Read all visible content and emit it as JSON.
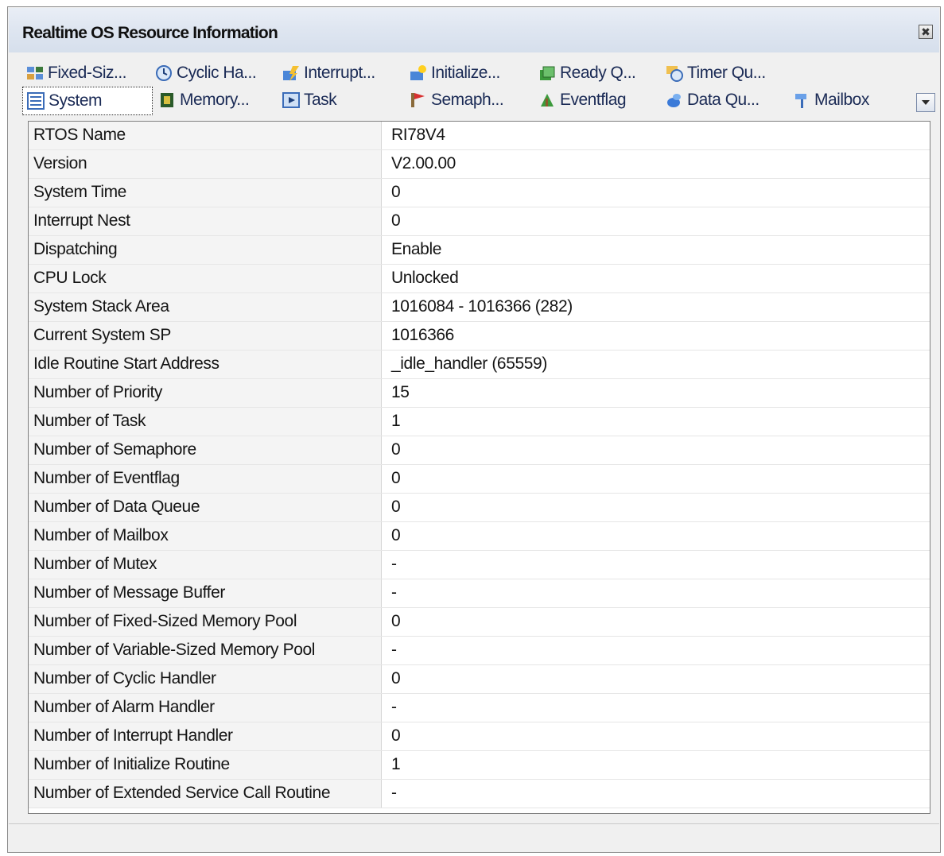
{
  "window": {
    "title": "Realtime OS Resource Information"
  },
  "tabs": {
    "row1": [
      {
        "id": "fixed",
        "label": "Fixed-Siz...",
        "icon": "fixed-size-memory-pool-icon"
      },
      {
        "id": "cyclic",
        "label": "Cyclic Ha...",
        "icon": "cyclic-handler-icon"
      },
      {
        "id": "interrupt",
        "label": "Interrupt...",
        "icon": "interrupt-handler-icon"
      },
      {
        "id": "initialize",
        "label": "Initialize...",
        "icon": "initialize-routine-icon"
      },
      {
        "id": "ready",
        "label": "Ready Q...",
        "icon": "ready-queue-icon"
      },
      {
        "id": "timer",
        "label": "Timer Qu...",
        "icon": "timer-queue-icon"
      }
    ],
    "row2": [
      {
        "id": "system",
        "label": "System",
        "icon": "system-icon",
        "selected": true
      },
      {
        "id": "memory",
        "label": "Memory...",
        "icon": "memory-icon"
      },
      {
        "id": "task",
        "label": "Task",
        "icon": "task-icon"
      },
      {
        "id": "semaphore",
        "label": "Semaph...",
        "icon": "semaphore-icon"
      },
      {
        "id": "eventflag",
        "label": "Eventflag",
        "icon": "eventflag-icon"
      },
      {
        "id": "dataqueue",
        "label": "Data Qu...",
        "icon": "data-queue-icon"
      },
      {
        "id": "mailbox",
        "label": "Mailbox",
        "icon": "mailbox-icon"
      }
    ]
  },
  "system_info": [
    {
      "name": "RTOS Name",
      "value": "RI78V4"
    },
    {
      "name": "Version",
      "value": "V2.00.00"
    },
    {
      "name": "System Time",
      "value": "0"
    },
    {
      "name": "Interrupt Nest",
      "value": "0"
    },
    {
      "name": "Dispatching",
      "value": "Enable"
    },
    {
      "name": "CPU Lock",
      "value": "Unlocked"
    },
    {
      "name": "System Stack Area",
      "value": "1016084 - 1016366 (282)"
    },
    {
      "name": "Current System SP",
      "value": "1016366"
    },
    {
      "name": "Idle Routine Start Address",
      "value": "_idle_handler (65559)"
    },
    {
      "name": "Number of Priority",
      "value": "15"
    },
    {
      "name": "Number of Task",
      "value": "1"
    },
    {
      "name": "Number of Semaphore",
      "value": "0"
    },
    {
      "name": "Number of Eventflag",
      "value": "0"
    },
    {
      "name": "Number of Data Queue",
      "value": "0"
    },
    {
      "name": "Number of Mailbox",
      "value": "0"
    },
    {
      "name": "Number of Mutex",
      "value": "-"
    },
    {
      "name": "Number of Message Buffer",
      "value": "-"
    },
    {
      "name": "Number of Fixed-Sized Memory Pool",
      "value": "0"
    },
    {
      "name": "Number of Variable-Sized Memory Pool",
      "value": "-"
    },
    {
      "name": "Number of Cyclic Handler",
      "value": "0"
    },
    {
      "name": "Number of Alarm Handler",
      "value": "-"
    },
    {
      "name": "Number of Interrupt Handler",
      "value": "0"
    },
    {
      "name": "Number of Initialize Routine",
      "value": "1"
    },
    {
      "name": "Number of Extended Service Call Routine",
      "value": "-"
    }
  ]
}
